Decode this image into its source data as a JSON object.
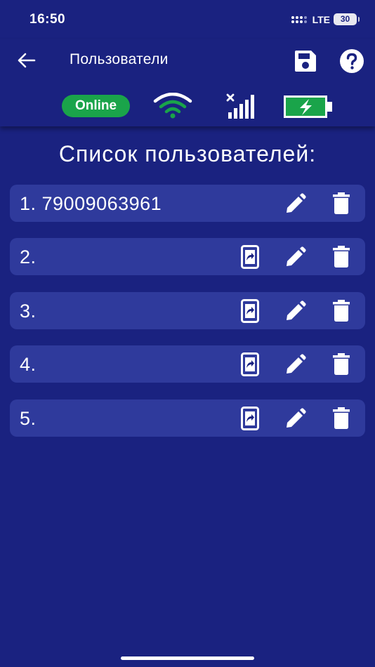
{
  "status_bar": {
    "time": "16:50",
    "network": "LTE",
    "battery": "30"
  },
  "header": {
    "title": "Пользователи",
    "back_icon": "arrow-left-icon",
    "save_icon": "floppy-disk-icon",
    "help_icon": "question-circle-icon"
  },
  "indicators": {
    "online_label": "Online",
    "online_color": "#1aa44a",
    "wifi_icon": "wifi-icon",
    "signal_icon": "cellular-no-signal-icon",
    "battery_icon": "battery-charging-icon",
    "battery_color": "#1aa44a"
  },
  "main": {
    "list_title": "Список пользователей:",
    "users": [
      {
        "label": "1. 79009063961",
        "has_phone_button": false
      },
      {
        "label": "2.",
        "has_phone_button": true
      },
      {
        "label": "3.",
        "has_phone_button": true
      },
      {
        "label": "4.",
        "has_phone_button": true
      },
      {
        "label": "5.",
        "has_phone_button": true
      }
    ]
  },
  "colors": {
    "background": "#1a2280",
    "row_background": "#2f3a9c",
    "text": "#ffffff"
  }
}
